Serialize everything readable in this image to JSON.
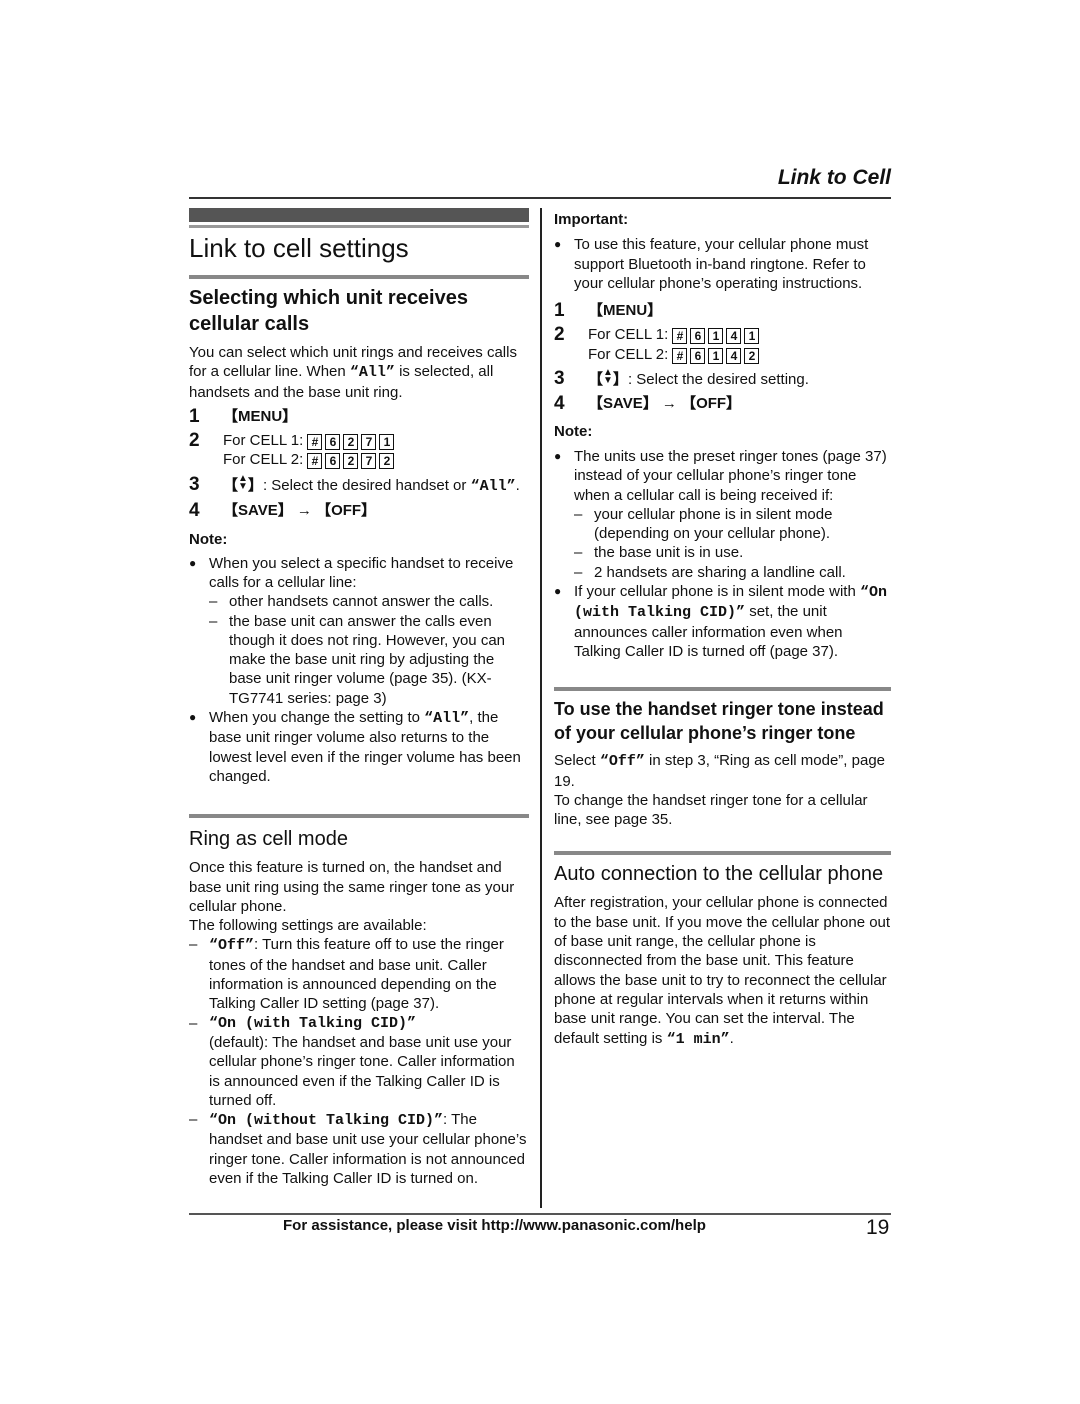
{
  "header": {
    "section_title": "Link to Cell"
  },
  "left": {
    "title": "Link to cell settings",
    "sec1": {
      "heading": "Selecting which unit receives cellular calls",
      "intro_a": "You can select which unit rings and receives calls for a cellular line. When ",
      "intro_code": "“All”",
      "intro_b": " is selected, all handsets and the base unit ring.",
      "steps": [
        {
          "num": "1",
          "key": "【MENU】"
        },
        {
          "num": "2",
          "cell1_label": "For CELL 1: ",
          "cell1_keys": [
            "#",
            "6",
            "2",
            "7",
            "1"
          ],
          "cell2_label": "For CELL 2: ",
          "cell2_keys": [
            "#",
            "6",
            "2",
            "7",
            "2"
          ]
        },
        {
          "num": "3",
          "key": "【",
          "key_end": "】",
          "text_a": ": Select the desired handset or ",
          "code": "“All”",
          "text_b": "."
        },
        {
          "num": "4",
          "text": "【SAVE】 → 【OFF】"
        }
      ],
      "note_label": "Note:",
      "bullet1": "When you select a specific handset to receive calls for a cellular line:",
      "bullet1_dashes": [
        "other handsets cannot answer the calls.",
        "the base unit can answer the calls even though it does not ring. However, you can make the base unit ring by adjusting the base unit ringer volume (page 35). (KX-TG7741 series: page 3)"
      ],
      "bullet2_a": "When you change the setting to ",
      "bullet2_code": "“All”",
      "bullet2_b": ", the base unit ringer volume also returns to the lowest level even if the ringer volume has been changed."
    },
    "sec2": {
      "heading": "Ring as cell mode",
      "intro": "Once this feature is turned on, the handset and base unit ring using the same ringer tone as your cellular phone.",
      "intro2": "The following settings are available:",
      "opt1_code": "“Off”",
      "opt1_text": ": Turn this feature off to use the ringer tones of the handset and base unit. Caller information is announced depending on the Talking Caller ID setting (page 37).",
      "opt2_code": "“On (with Talking CID)”",
      "opt2_text": "(default): The handset and base unit use your cellular phone’s ringer tone. Caller information is announced even if the Talking Caller ID is turned off.",
      "opt3_code": "“On (without Talking CID)”",
      "opt3_text": ": The handset and base unit use your cellular phone’s ringer tone. Caller information is not announced even if the Talking Caller ID is turned on."
    }
  },
  "right": {
    "important_label": "Important:",
    "important_text": "To use this feature, your cellular phone must support Bluetooth in-band ringtone. Refer to your cellular phone’s operating instructions.",
    "steps": [
      {
        "num": "1",
        "key": "【MENU】"
      },
      {
        "num": "2",
        "cell1_label": "For CELL 1: ",
        "cell1_keys": [
          "#",
          "6",
          "1",
          "4",
          "1"
        ],
        "cell2_label": "For CELL 2: ",
        "cell2_keys": [
          "#",
          "6",
          "1",
          "4",
          "2"
        ]
      },
      {
        "num": "3",
        "key": "【",
        "key_end": "】",
        "text": ": Select the desired setting."
      },
      {
        "num": "4",
        "text": "【SAVE】 → 【OFF】"
      }
    ],
    "note_label": "Note:",
    "note_bullet1": "The units use the preset ringer tones (page 37) instead of your cellular phone’s ringer tone when a cellular call is being received if:",
    "note_dashes": [
      "your cellular phone is in silent mode (depending on your cellular phone).",
      "the base unit is in use.",
      "2 handsets are sharing a landline call."
    ],
    "note_bullet2_a": "If your cellular phone is in silent mode with ",
    "note_bullet2_code": "“On (with Talking CID)”",
    "note_bullet2_b": " set, the unit announces caller information even when Talking Caller ID is turned off (page 37).",
    "sec3": {
      "heading": "To use the handset ringer tone instead of your cellular phone’s ringer tone",
      "p1_a": "Select ",
      "p1_code": "“Off”",
      "p1_b": " in step 3, “Ring as cell mode”, page 19.",
      "p2": "To change the handset ringer tone for a cellular line, see page 35."
    },
    "sec4": {
      "heading": "Auto connection to the cellular phone",
      "p_a": "After registration, your cellular phone is connected to the base unit. If you move the cellular phone out of base unit range, the cellular phone is disconnected from the base unit. This feature allows the base unit to try to reconnect the cellular phone at regular intervals when it returns within base unit range. You can set the interval. The default setting is ",
      "p_code": "“1 min”",
      "p_b": "."
    }
  },
  "footer": {
    "assist": "For assistance, please visit http://www.panasonic.com/help",
    "page_number": "19"
  }
}
